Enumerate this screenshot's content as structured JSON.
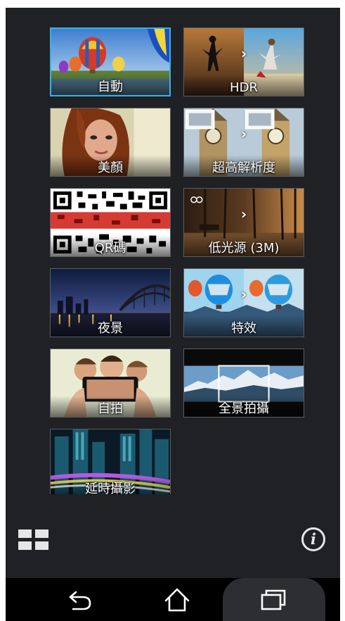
{
  "modes": [
    {
      "id": "auto",
      "label": "自動",
      "selected": true
    },
    {
      "id": "hdr",
      "label": "HDR",
      "selected": false
    },
    {
      "id": "beautification",
      "label": "美顏",
      "selected": false
    },
    {
      "id": "super-resolution",
      "label": "超高解析度",
      "selected": false
    },
    {
      "id": "qr-code",
      "label": "QR碼",
      "selected": false
    },
    {
      "id": "low-light",
      "label": "低光源 (3M)",
      "selected": false
    },
    {
      "id": "night",
      "label": "夜景",
      "selected": false
    },
    {
      "id": "effect",
      "label": "特效",
      "selected": false
    },
    {
      "id": "selfie",
      "label": "自拍",
      "selected": false
    },
    {
      "id": "panorama",
      "label": "全景拍攝",
      "selected": false
    },
    {
      "id": "time-lapse",
      "label": "延時攝影",
      "selected": false
    }
  ],
  "icons": {
    "grid": "grid-view-icon",
    "info": "info-icon",
    "back": "back-icon",
    "home": "home-icon",
    "recent": "recent-apps-icon"
  },
  "colors": {
    "background": "#202124",
    "selected_border": "#35b3e6",
    "navbar": "#000000"
  }
}
